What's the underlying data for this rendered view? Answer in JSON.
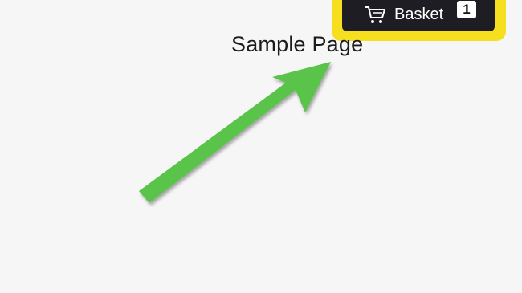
{
  "page": {
    "title": "Sample Page"
  },
  "header": {
    "basket": {
      "label": "Basket",
      "count": "1",
      "icon": "cart-icon"
    }
  },
  "annotation": {
    "arrow_color": "#5ac34a",
    "highlight_color": "#f5df1e"
  }
}
